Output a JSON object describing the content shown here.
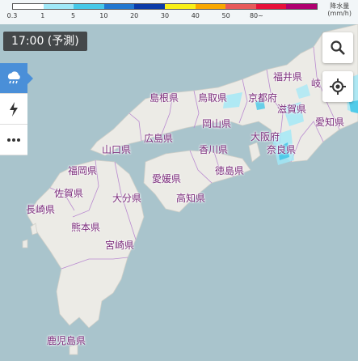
{
  "legend": {
    "colors": [
      "#ffffff",
      "#a0e8f8",
      "#46c8e8",
      "#2178d0",
      "#0a3aa8",
      "#f8f018",
      "#f8a800",
      "#e85a5a",
      "#e8113a",
      "#b00070"
    ],
    "ticks": [
      "0.3",
      "1",
      "5",
      "10",
      "20",
      "30",
      "40",
      "50",
      "80~"
    ],
    "unit_line1": "降水量",
    "unit_line2": "(mm/h)"
  },
  "time_label": "17:00 (予測)",
  "prefectures": {
    "fukui": "福井県",
    "gifu": "岐",
    "shimane": "島根県",
    "tottori": "鳥取県",
    "kyoto": "京都府",
    "shiga": "滋賀県",
    "aichi": "愛知県",
    "okayama": "岡山県",
    "hiroshima": "広島県",
    "osaka": "大阪府",
    "nara": "奈良県",
    "yamaguchi": "山口県",
    "kagawa": "香川県",
    "fukuoka": "福岡県",
    "tokushima": "徳島県",
    "ehime": "愛媛県",
    "saga": "佐賀県",
    "oita": "大分県",
    "kochi": "高知県",
    "nagasaki": "長崎県",
    "kumamoto": "熊本県",
    "miyazaki": "宮崎県",
    "kagoshima": "鹿児島県"
  },
  "icons": {
    "rain": "rain-cloud-icon",
    "lightning": "lightning-icon",
    "more": "more-icon",
    "search": "search-icon",
    "location": "location-icon"
  }
}
